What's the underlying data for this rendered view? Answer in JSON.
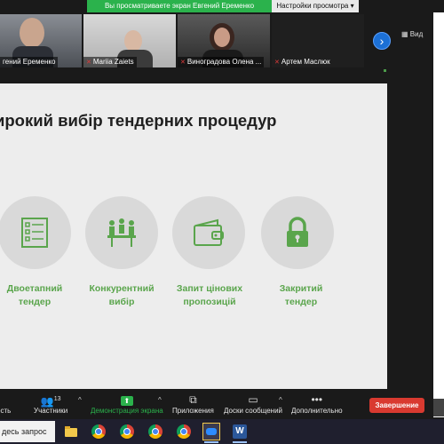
{
  "banner": {
    "sharing_text": "Вы просматриваете экран Евгений Еременко",
    "settings_label": "Настройки просмотра",
    "settings_caret": "▾"
  },
  "participants": [
    {
      "name": "Евгений Еременко",
      "display": "гений Еременко"
    },
    {
      "name": "Mariia Zaiets",
      "display": "Mariia Zaiets"
    },
    {
      "name": "Виноградова Олена ...",
      "display": "Виноградова Олена ..."
    },
    {
      "name": "Артем Маслюк",
      "display": "Артем Маслюк"
    }
  ],
  "strip": {
    "next_arrow": "›",
    "view_label": "Вид"
  },
  "slide": {
    "title": "Широкий вибір тендерних процедур",
    "title_visible": "ирокий вибір тендерних процедур",
    "accent_color": "#5aa54c",
    "procedures": [
      {
        "icon": "checklist-icon",
        "label_line1": "Двоетапний",
        "label_line2": "тендер"
      },
      {
        "icon": "meeting-icon",
        "label_line1": "Конкурентний",
        "label_line2": "вибір"
      },
      {
        "icon": "wallet-icon",
        "label_line1": "Запит цінових",
        "label_line2": "пропозицій"
      },
      {
        "icon": "lock-icon",
        "label_line1": "Закритий",
        "label_line2": "тендер"
      }
    ]
  },
  "toolbar": {
    "items": [
      {
        "label": "ость",
        "icon": ""
      },
      {
        "label": "Участники",
        "icon": "👥",
        "count": "13"
      },
      {
        "label": "Демонстрация экрана",
        "icon": "⬆"
      },
      {
        "label": "Приложения",
        "icon": "⧉"
      },
      {
        "label": "Доски сообщений",
        "icon": "▭"
      },
      {
        "label": "Дополнительно",
        "icon": "•••"
      }
    ],
    "end_label": "Завершение",
    "share_color": "#2bb24c",
    "end_color": "#d93a30"
  },
  "taskbar": {
    "search_text": "десь запрос",
    "apps": [
      "file-explorer-icon",
      "chrome-icon",
      "chrome-icon",
      "chrome-icon",
      "chrome-icon",
      "zoom-icon",
      "word-icon"
    ]
  }
}
